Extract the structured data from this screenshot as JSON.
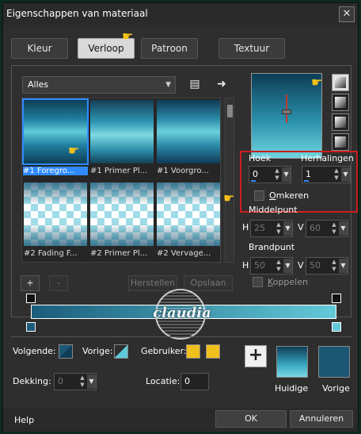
{
  "window": {
    "title": "Eigenschappen van materiaal",
    "close_label": "✕"
  },
  "tabs": [
    {
      "label": "Kleur"
    },
    {
      "label": "Verloop",
      "active": true
    },
    {
      "label": "Patroon"
    },
    {
      "label": "Textuur"
    }
  ],
  "category": {
    "selected": "Alles"
  },
  "thumbnails": [
    {
      "label": "#1 Foregro..."
    },
    {
      "label": "#1 Primer Pl..."
    },
    {
      "label": "#1 Voorgro..."
    },
    {
      "label": "#2 Fading F..."
    },
    {
      "label": "#2 Primer Pl..."
    },
    {
      "label": "#2 Vervage..."
    }
  ],
  "controls": {
    "hoek_label": "Hoek",
    "hoek_value": "0",
    "herhalingen_label": "Herhalingen",
    "herhalingen_value": "1",
    "omkeren_label": "Omkeren",
    "middelpunt_label": "Middelpunt",
    "mid_h_label": "H",
    "mid_h_value": "25",
    "mid_v_label": "V",
    "mid_v_value": "60",
    "brandpunt_label": "Brandpunt",
    "brand_h_label": "H",
    "brand_h_value": "50",
    "brand_v_label": "V",
    "brand_v_value": "50",
    "koppelen_label": "Koppelen"
  },
  "grid_buttons": {
    "add": "+",
    "remove": "-",
    "herstellen": "Herstellen",
    "opslaan": "Opslaan"
  },
  "bottom": {
    "volgende_label": "Volgende:",
    "vorige_label": "Vorige:",
    "gebruiker_label": "Gebruiker:",
    "dekking_label": "Dekking:",
    "dekking_value": "0",
    "locatie_label": "Locatie:",
    "locatie_value": "0",
    "huidige_label": "Huidige",
    "vorige_swatch_label": "Vorige",
    "add_symbol": "+"
  },
  "footer": {
    "help": "Help",
    "ok": "OK",
    "annuleren": "Annuleren"
  },
  "watermark": {
    "text": "claudia"
  },
  "colors": {
    "selection": "#2e8bff",
    "highlight_box": "#cc1e1e",
    "gebruiker": "#f2c01d",
    "huidige_top": "#0e3d56",
    "vorige_swatch": "#1b5673",
    "gradient_start": "#1a5d7a",
    "gradient_end": "#63c9d9"
  }
}
